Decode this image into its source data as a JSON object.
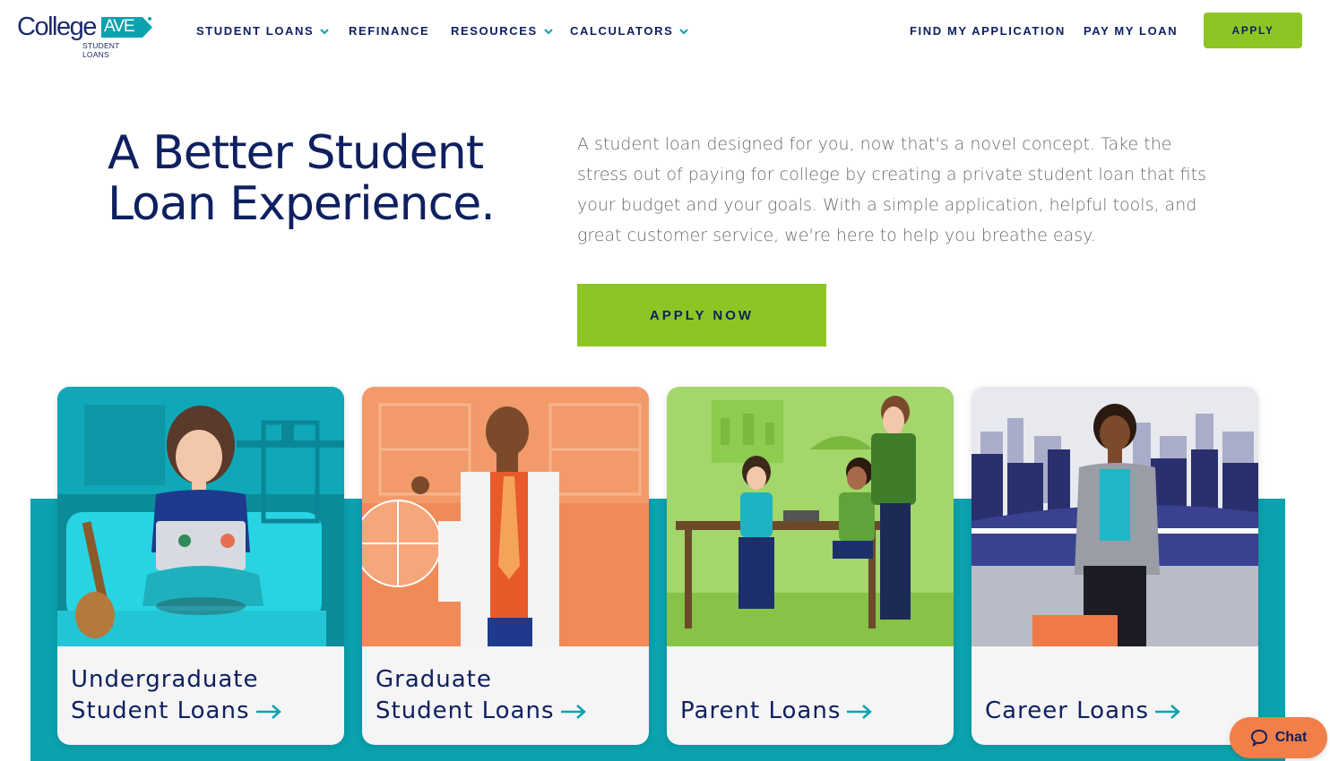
{
  "brand": {
    "word": "College",
    "ave": "AVE",
    "sub": "STUDENT LOANS",
    "colors": {
      "navy": "#0f2060",
      "green": "#8dc624",
      "teal": "#0aa2ae",
      "orange": "#f07f4a"
    }
  },
  "nav": {
    "student_loans": "STUDENT LOANS",
    "refinance": "REFINANCE",
    "resources": "RESOURCES",
    "calculators": "CALCULATORS",
    "find_application": "FIND MY APPLICATION",
    "pay_loan": "PAY MY LOAN",
    "apply": "APPLY"
  },
  "hero": {
    "title": "A Better Student Loan Experience.",
    "description": "A student loan designed for you, now that's a novel concept. Take the stress out of paying for college by creating a private student loan that fits your budget and your goals. With a simple application, helpful tools, and great customer service, we're here to help you breathe easy.",
    "cta": "APPLY NOW"
  },
  "cards": [
    {
      "line1": "Undergraduate",
      "line2": "Student Loans",
      "icon": "arrow-right-icon"
    },
    {
      "line1": "Graduate",
      "line2": "Student Loans",
      "icon": "arrow-right-icon"
    },
    {
      "line1": "",
      "line2": "Parent Loans",
      "icon": "arrow-right-icon"
    },
    {
      "line1": "",
      "line2": "Career Loans",
      "icon": "arrow-right-icon"
    }
  ],
  "chat": {
    "label": "Chat",
    "icon": "chat-bubble-icon"
  }
}
